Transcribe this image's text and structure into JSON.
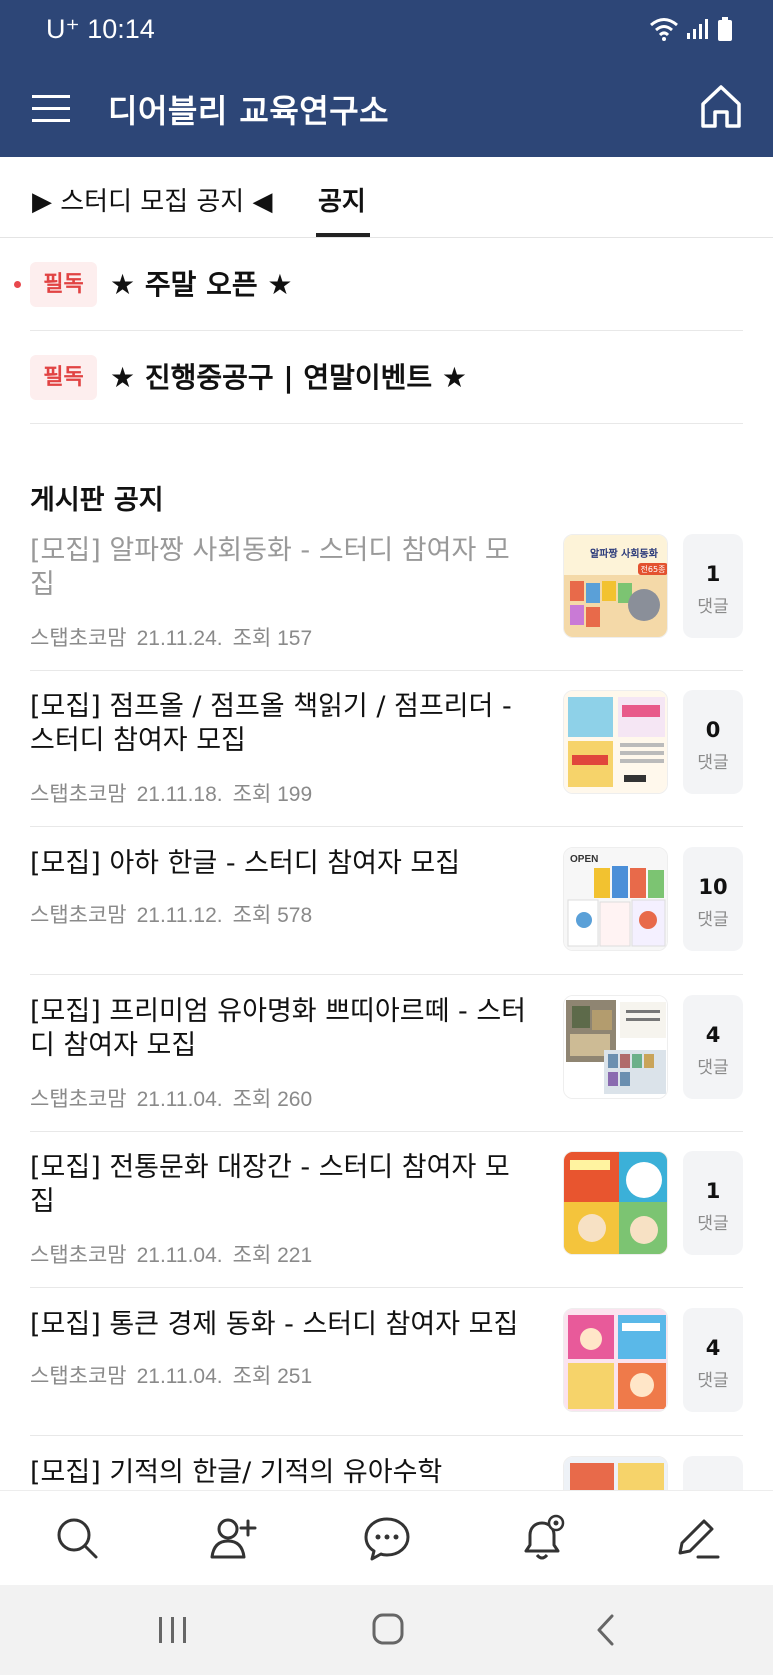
{
  "status_bar": {
    "carrier": "U⁺ 10:14"
  },
  "header": {
    "title": "디어블리 교육연구소"
  },
  "tabs": [
    {
      "label": "▶ 스터디 모집 공지 ◀"
    },
    {
      "label": "공지",
      "active": true
    }
  ],
  "pinned": [
    {
      "badge": "필독",
      "title": "★ 주말 오픈 ★",
      "unread": true
    },
    {
      "badge": "필독",
      "title": "★ 진행중공구 | 연말이벤트 ★",
      "unread": false
    }
  ],
  "section_title": "게시판 공지",
  "posts": [
    {
      "title": "[모집] 알파짱 사회동화 - 스터디 참여자 모집",
      "author": "스탭초코맘",
      "date": "21.11.24.",
      "views": "조회 157",
      "comments": "1",
      "comment_label": "댓글",
      "read": true
    },
    {
      "title": "[모집] 점프올 / 점프올 책읽기 / 점프리더 - 스터디 참여자 모집",
      "author": "스탭초코맘",
      "date": "21.11.18.",
      "views": "조회 199",
      "comments": "0",
      "comment_label": "댓글",
      "read": false
    },
    {
      "title": "[모집] 아하 한글 - 스터디 참여자 모집",
      "author": "스탭초코맘",
      "date": "21.11.12.",
      "views": "조회 578",
      "comments": "10",
      "comment_label": "댓글",
      "read": false
    },
    {
      "title": "[모집] 프리미엄 유아명화 쁘띠아르떼 - 스터디 참여자 모집",
      "author": "스탭초코맘",
      "date": "21.11.04.",
      "views": "조회 260",
      "comments": "4",
      "comment_label": "댓글",
      "read": false
    },
    {
      "title": "[모집] 전통문화 대장간 - 스터디 참여자 모집",
      "author": "스탭초코맘",
      "date": "21.11.04.",
      "views": "조회 221",
      "comments": "1",
      "comment_label": "댓글",
      "read": false
    },
    {
      "title": "[모집] 통큰 경제 동화 - 스터디 참여자 모집",
      "author": "스탭초코맘",
      "date": "21.11.04.",
      "views": "조회 251",
      "comments": "4",
      "comment_label": "댓글",
      "read": false
    },
    {
      "title": "[모집] 기적의 한글/ 기적의 유아수학",
      "author": "",
      "date": "",
      "views": "",
      "comments": "",
      "comment_label": "",
      "read": false
    }
  ],
  "thumb_labels": {
    "t1_title": "알파짱 사회동화",
    "t1_badge": "전65종",
    "t3_label": "OPEN"
  },
  "colors": {
    "header_bg": "#2d4677",
    "badge_text": "#e14343",
    "badge_bg": "#fdeeee"
  },
  "icons": {
    "bottom_nav": [
      "search-icon",
      "add-member-icon",
      "chat-icon",
      "notification-settings-icon",
      "write-icon"
    ],
    "system_nav": [
      "recent-apps-icon",
      "home-icon",
      "back-icon"
    ]
  }
}
